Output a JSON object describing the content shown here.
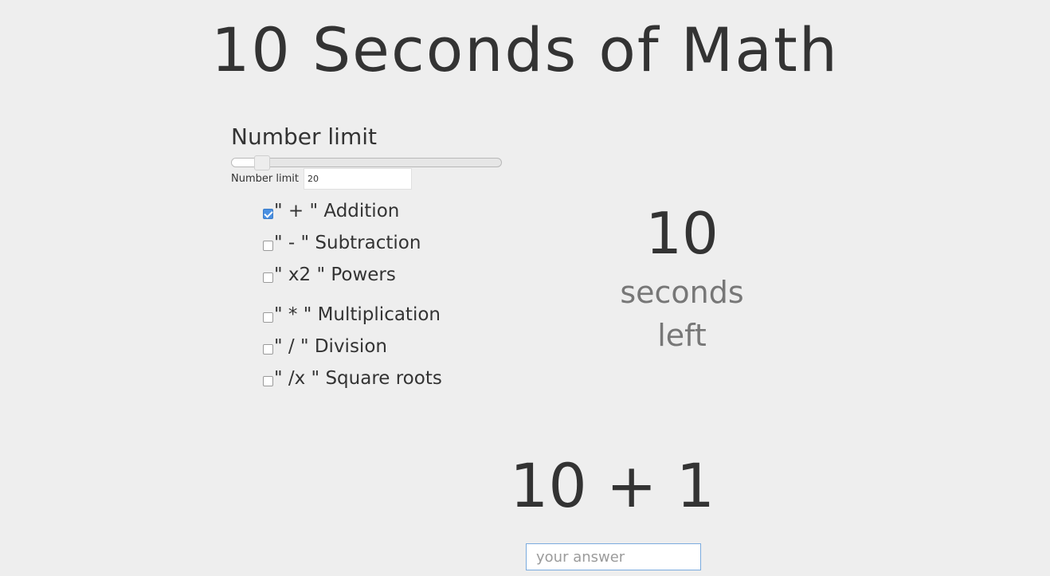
{
  "title": "10 Seconds of Math",
  "number_limit": {
    "heading": "Number limit",
    "field_label": "Number limit",
    "value": "20",
    "slider_fraction": 0.11
  },
  "operations": [
    {
      "label": "\" + \" Addition",
      "checked": true
    },
    {
      "label": "\" - \" Subtraction",
      "checked": false
    },
    {
      "label": "\" x2 \" Powers",
      "checked": false
    },
    {
      "label": "\" * \" Multiplication",
      "checked": false
    },
    {
      "label": "\" / \" Division",
      "checked": false
    },
    {
      "label": "\" /x \" Square roots",
      "checked": false
    }
  ],
  "timer": {
    "value": "10",
    "label": "seconds left"
  },
  "problem": "10 + 1",
  "answer": {
    "placeholder": "your answer",
    "value": ""
  },
  "colors": {
    "background": "#eeeeee",
    "text": "#333333",
    "muted_text": "#777777",
    "checkbox_checked": "#4a90e2",
    "input_focus_border": "#7aabde"
  }
}
